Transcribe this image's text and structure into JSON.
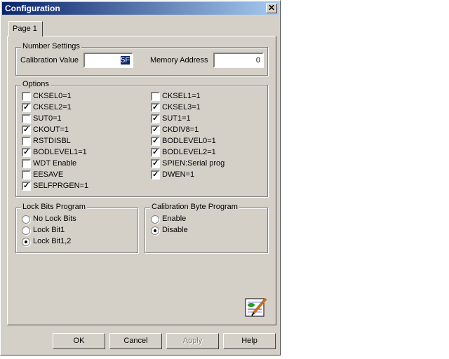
{
  "window": {
    "title": "Configuration",
    "close": "✕"
  },
  "tabs": [
    {
      "label": "Page 1"
    }
  ],
  "number_settings": {
    "legend": "Number Settings",
    "calibration_label": "Calibration Value",
    "calibration_value": "5F",
    "memory_label": "Memory Address",
    "memory_value": "0"
  },
  "options": {
    "legend": "Options",
    "left": [
      {
        "label": "CKSEL0=1",
        "checked": false
      },
      {
        "label": "CKSEL2=1",
        "checked": true
      },
      {
        "label": "SUT0=1",
        "checked": false
      },
      {
        "label": "CKOUT=1",
        "checked": true
      },
      {
        "label": "RSTDISBL",
        "checked": false
      },
      {
        "label": "BODLEVEL1=1",
        "checked": true
      },
      {
        "label": "WDT Enable",
        "checked": false
      },
      {
        "label": "EESAVE",
        "checked": false
      },
      {
        "label": "SELFPRGEN=1",
        "checked": true
      }
    ],
    "right": [
      {
        "label": "CKSEL1=1",
        "checked": false
      },
      {
        "label": "CKSEL3=1",
        "checked": true
      },
      {
        "label": "SUT1=1",
        "checked": true
      },
      {
        "label": "CKDIV8=1",
        "checked": true
      },
      {
        "label": "BODLEVEL0=1",
        "checked": true
      },
      {
        "label": "BODLEVEL2=1",
        "checked": true
      },
      {
        "label": "SPIEN:Serial prog",
        "checked": true
      },
      {
        "label": "DWEN=1",
        "checked": true
      }
    ]
  },
  "lock_bits": {
    "legend": "Lock Bits Program",
    "options": [
      {
        "label": "No Lock Bits",
        "selected": false
      },
      {
        "label": "Lock Bit1",
        "selected": false
      },
      {
        "label": "Lock Bit1,2",
        "selected": true
      }
    ]
  },
  "calibration_byte": {
    "legend": "Calibration Byte Program",
    "options": [
      {
        "label": "Enable",
        "selected": false
      },
      {
        "label": "Disable",
        "selected": true
      }
    ]
  },
  "buttons": {
    "ok": "OK",
    "cancel": "Cancel",
    "apply": "Apply",
    "help": "Help"
  }
}
